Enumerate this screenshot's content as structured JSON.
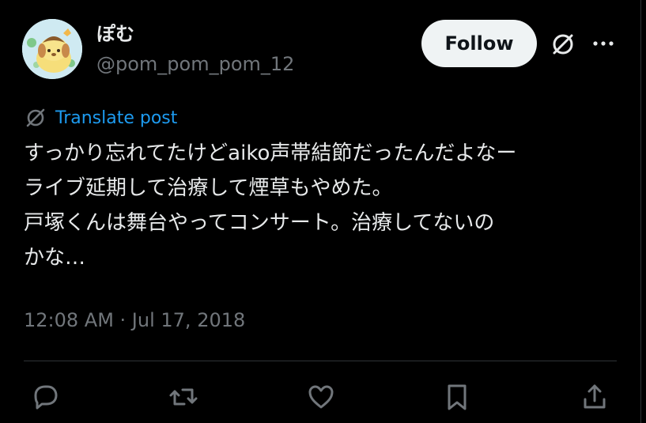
{
  "author": {
    "display_name": "ぽむ",
    "handle": "@pom_pom_pom_12",
    "avatar_icon": "pompompurin-avatar"
  },
  "header_actions": {
    "follow_label": "Follow",
    "grok_icon": "grok-icon",
    "more_icon": "more-icon"
  },
  "post": {
    "translate_label": "Translate post",
    "lines": [
      "すっかり忘れてたけどaiko声帯結節だったんだよなー",
      "ライブ延期して治療して煙草もやめた。",
      "戸塚くんは舞台やってコンサート。治療してないの",
      "かな…"
    ],
    "timestamp": "12:08 AM · Jul 17, 2018"
  },
  "actions": [
    {
      "icon": "reply-icon"
    },
    {
      "icon": "repost-icon"
    },
    {
      "icon": "like-icon"
    },
    {
      "icon": "bookmark-icon"
    },
    {
      "icon": "share-icon"
    }
  ],
  "colors": {
    "background": "#000000",
    "text": "#e7e9ea",
    "secondary": "#71767b",
    "link": "#1d9bf0",
    "button_bg": "#eff3f4"
  }
}
